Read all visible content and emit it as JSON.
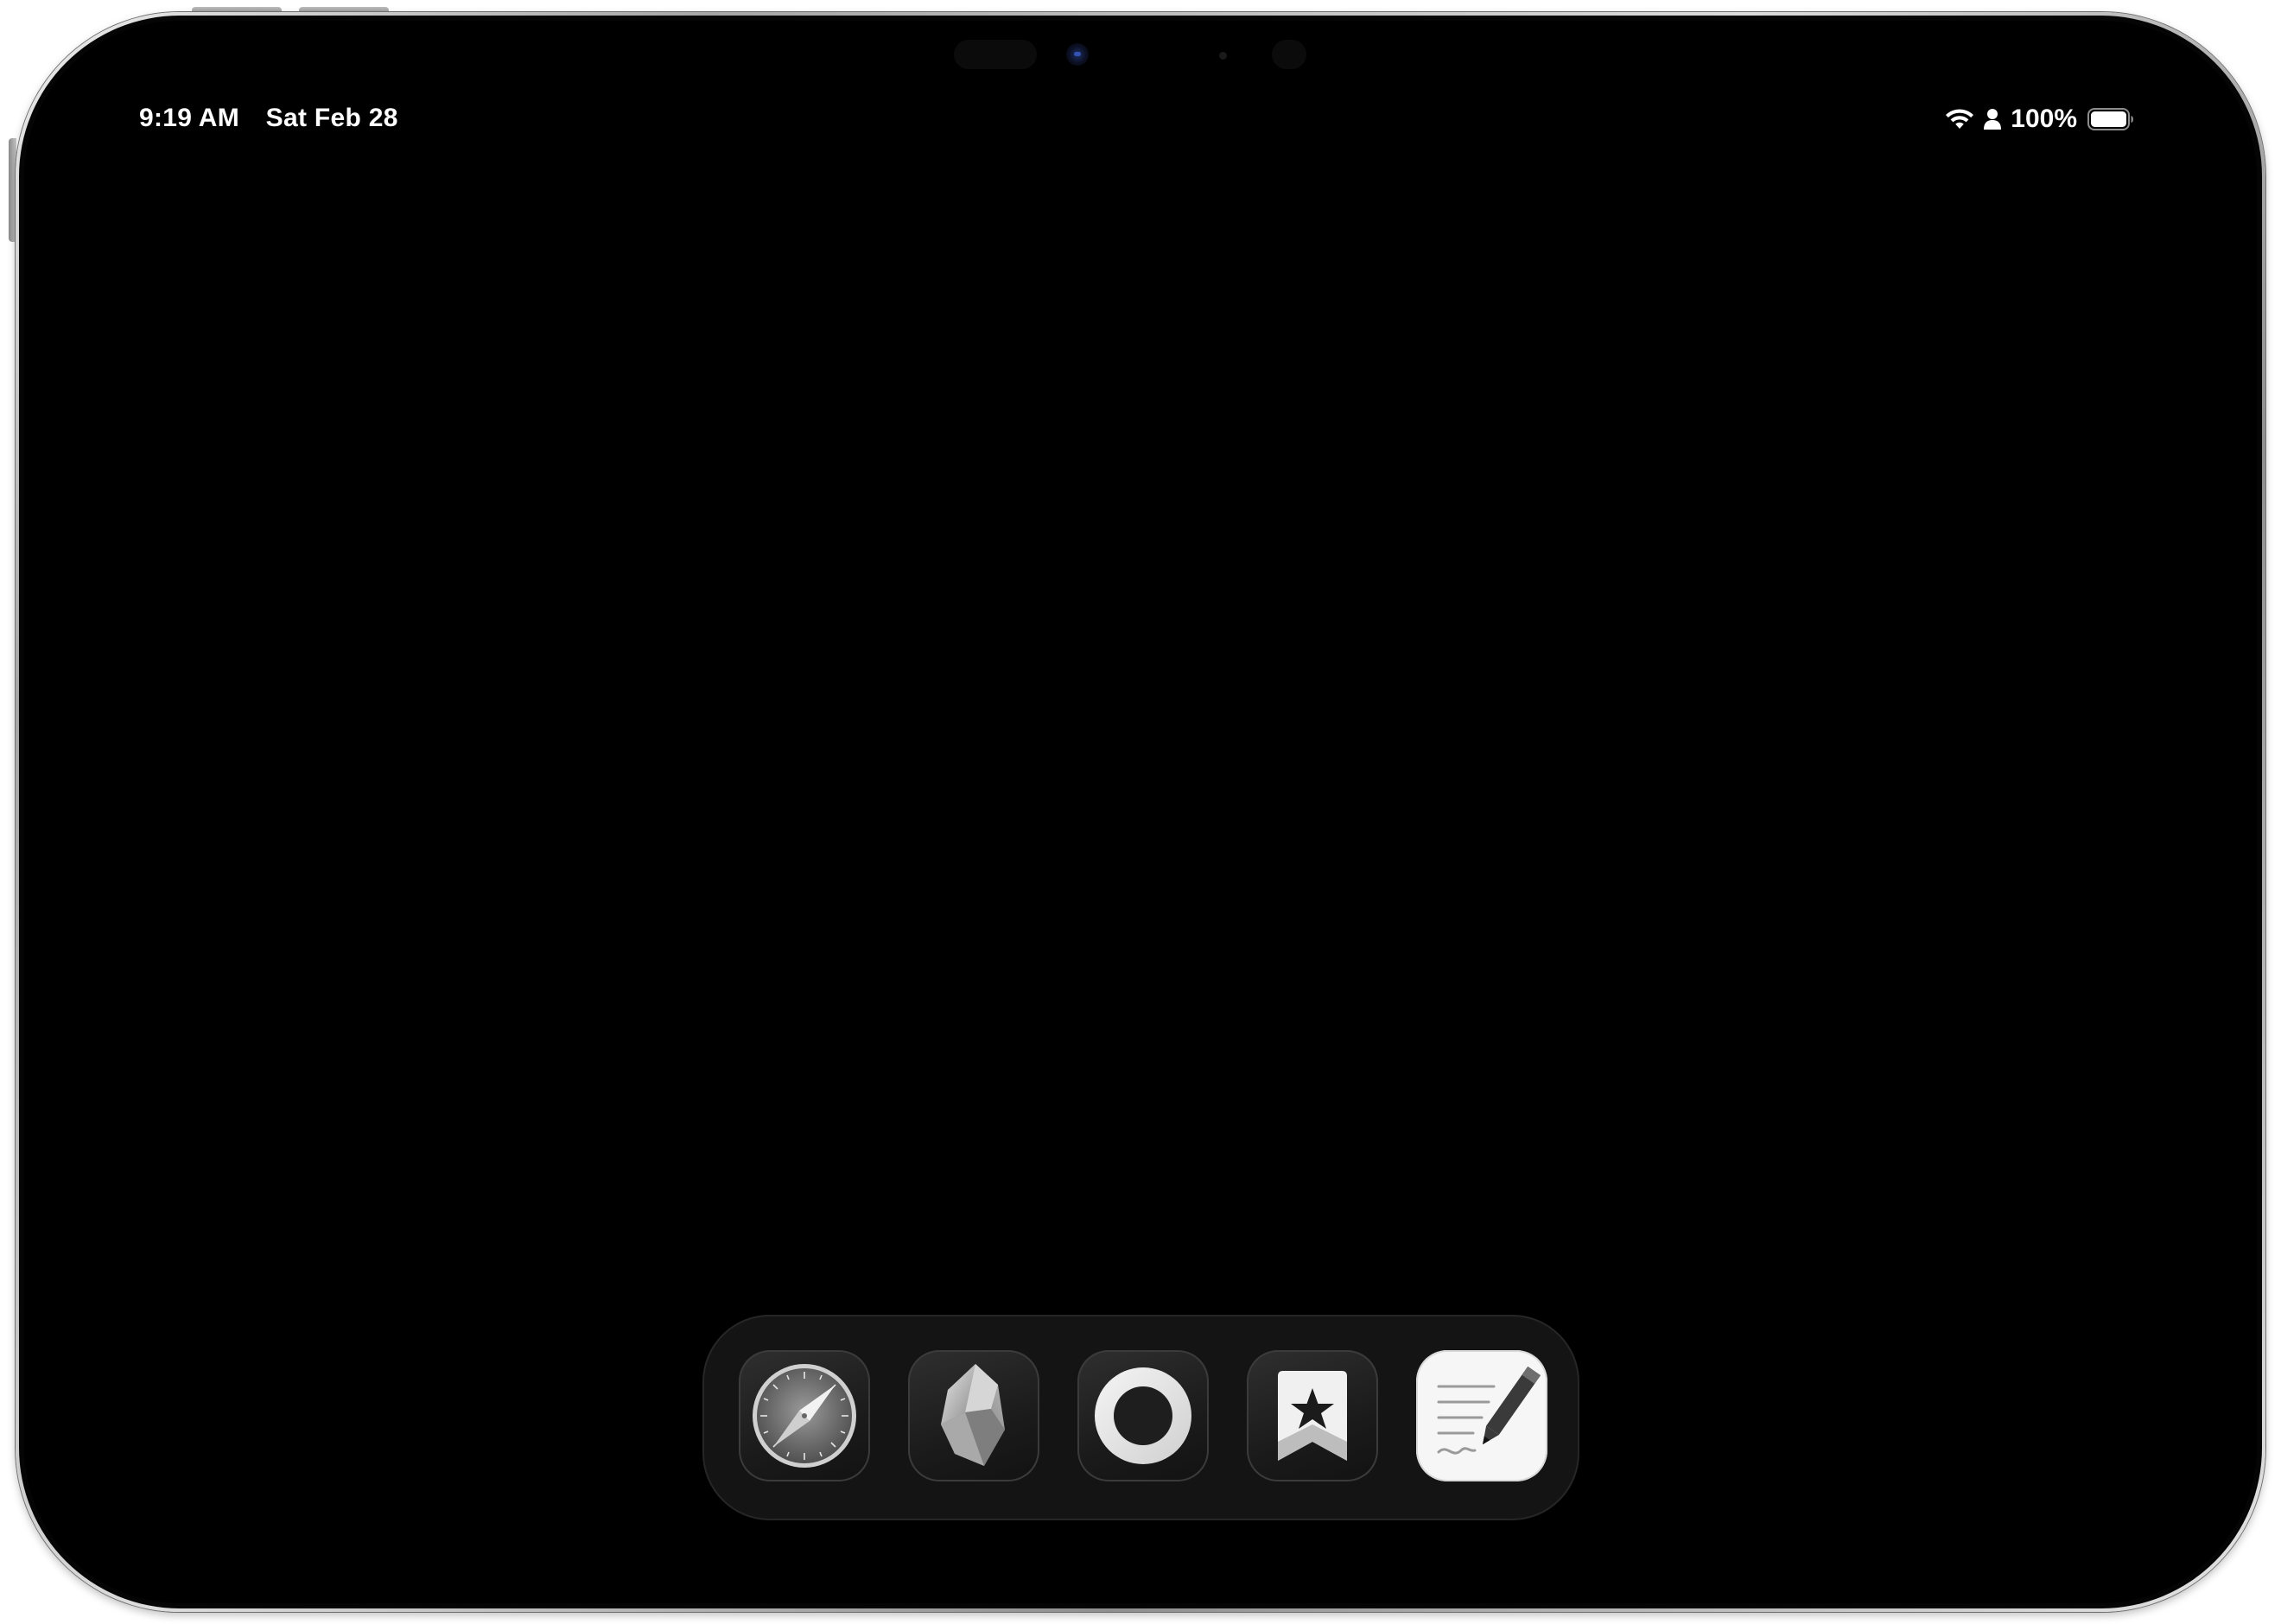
{
  "status_bar": {
    "time": "9:19 AM",
    "date": "Sat Feb 28",
    "battery_percent": "100%",
    "icons": [
      "wifi-icon",
      "person-icon",
      "battery-icon"
    ]
  },
  "dock": {
    "apps": [
      {
        "icon": "safari-compass-icon"
      },
      {
        "icon": "obsidian-crystal-icon"
      },
      {
        "icon": "ring-circle-icon"
      },
      {
        "icon": "bookmark-star-icon"
      },
      {
        "icon": "notes-pencil-icon"
      }
    ]
  },
  "colors": {
    "screen": "#000000",
    "dock": "#141414",
    "text": "#ffffff"
  }
}
